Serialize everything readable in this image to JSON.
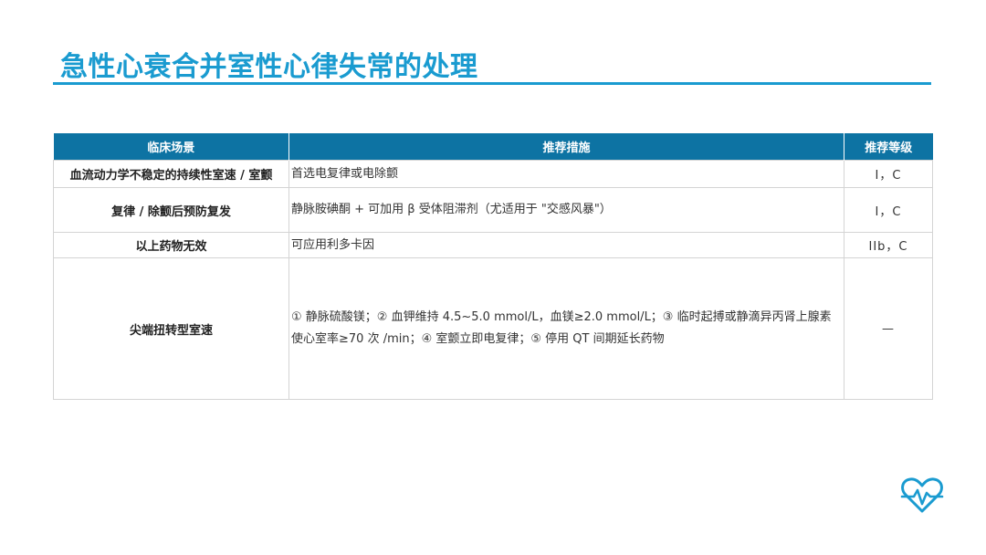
{
  "title": "急性心衰合并室性心律失常的处理",
  "table": {
    "headers": [
      "临床场景",
      "推荐措施",
      "推荐等级"
    ],
    "rows": [
      {
        "scene": "血流动力学不稳定的持续性室速 / 室颤",
        "measure": "首选电复律或电除颤",
        "grade": "I，C"
      },
      {
        "scene": "复律 / 除颤后预防复发",
        "measure": "静脉胺碘酮 + 可加用 β 受体阻滞剂（尤适用于 \"交感风暴\"）",
        "grade": "I，C"
      },
      {
        "scene": "以上药物无效",
        "measure": "可应用利多卡因",
        "grade": "IIb，C"
      },
      {
        "scene": "尖端扭转型室速",
        "measure": "① 静脉硫酸镁；② 血钾维持 4.5~5.0 mmol/L，血镁≥2.0 mmol/L；③ 临时起搏或静滴异丙肾上腺素使心室率≥70 次 /min；④ 室颤立即电复律；⑤ 停用 QT 间期延长药物",
        "grade": "—"
      }
    ]
  },
  "colors": {
    "title": "#1a9bd0",
    "header_bg": "#0d73a3",
    "heart": "#1a9bd0"
  },
  "icons": {
    "logo": "heart-pulse-icon"
  }
}
